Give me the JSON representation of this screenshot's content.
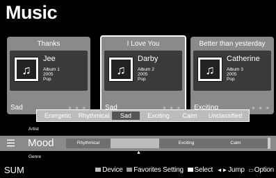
{
  "app": {
    "title": "Music"
  },
  "cards": [
    {
      "title": "Thanks",
      "artist": "Jee",
      "album": "Album 1",
      "year": "2005",
      "genre": "Pop",
      "mood": "Sad",
      "stars": "★ ★ ★",
      "selected": false
    },
    {
      "title": "I Love You",
      "artist": "Darby",
      "album": "Album 2",
      "year": "2005",
      "genre": "Pop",
      "mood": "Sad",
      "stars": "★ ★ ★",
      "selected": true
    },
    {
      "title": "Better than yesterday",
      "artist": "Catherine",
      "album": "Album 3",
      "year": "2005",
      "genre": "Pop",
      "mood": "Exciting",
      "stars": "★ ★ ★",
      "selected": false
    }
  ],
  "mood_popup": {
    "options": [
      "Energetic",
      "Rhythmical",
      "Sad",
      "Exciting",
      "Calm",
      "Unclassified"
    ],
    "selected": "Sad"
  },
  "sort_bar": {
    "above_label": "Artist",
    "current_label": "Mood",
    "below_label": "Genre",
    "track_items": [
      "Rhythmical",
      "",
      "Exciting",
      "Calm"
    ],
    "pointer": "▲"
  },
  "bottom_bar": {
    "logo": "SUM",
    "device_label": "Device",
    "favorites_label": "Favorites Setting",
    "select_label": "Select",
    "jump_label": "Jump",
    "option_label": "Option",
    "jump_icon": "◄►",
    "option_icon": "▭"
  }
}
